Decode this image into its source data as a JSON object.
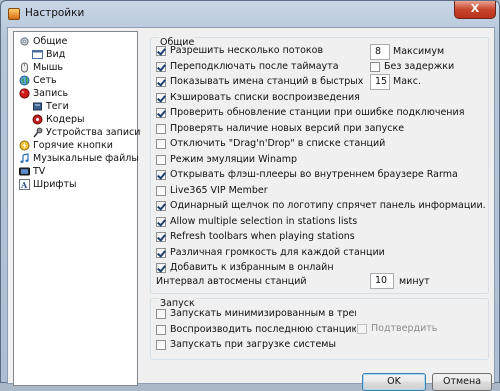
{
  "window": {
    "title": "Настройки",
    "close_label": "X"
  },
  "tree": {
    "items": [
      {
        "label": "Общие"
      },
      {
        "label": "Вид"
      },
      {
        "label": "Мышь"
      },
      {
        "label": "Сеть"
      },
      {
        "label": "Запись"
      },
      {
        "label": "Теги"
      },
      {
        "label": "Кодеры"
      },
      {
        "label": "Устройства записи"
      },
      {
        "label": "Горячие кнопки"
      },
      {
        "label": "Музыкальные файлы"
      },
      {
        "label": "TV"
      },
      {
        "label": "Шрифты"
      }
    ]
  },
  "general": {
    "title": "Общие",
    "options": [
      {
        "label": "Разрешить несколько потоков",
        "checked": true
      },
      {
        "label": "Переподключать после таймаута",
        "checked": true
      },
      {
        "label": "Показывать имена станций в быстрых предустановках",
        "checked": true
      },
      {
        "label": "Кэшировать списки воспроизведения",
        "checked": true
      },
      {
        "label": "Проверить обновление станции при ошибке подключения",
        "checked": true
      },
      {
        "label": "Проверять наличие новых версий при запуске",
        "checked": false
      },
      {
        "label": "Отключить \"Drag'n'Drop\" в списке станций",
        "checked": false
      },
      {
        "label": "Режим эмуляции Winamp",
        "checked": false
      },
      {
        "label": "Открывать флэш-плееры во внутреннем браузере Rarma",
        "checked": true
      },
      {
        "label": "Live365 VIP Member",
        "checked": false
      },
      {
        "label": "Одинарный щелчок по логотипу спрячет панель информации.",
        "checked": true
      },
      {
        "label": "Allow multiple selection in stations lists",
        "checked": true
      },
      {
        "label": "Refresh toolbars when playing stations",
        "checked": true
      },
      {
        "label": "Различная громкость для каждой станции",
        "checked": true
      },
      {
        "label": "Добавить к избранным в онлайн",
        "checked": true
      }
    ],
    "max_streams_value": "8",
    "max_streams_label": "Максимум",
    "no_delay_label": "Без задержки",
    "no_delay_checked": false,
    "max_names_value": "15",
    "max_names_label": "Макс.",
    "interval_label": "Интервал автосмены станций",
    "interval_value": "10",
    "interval_unit": "минут"
  },
  "launch": {
    "title": "Запуск",
    "options": [
      {
        "label": "Запускать минимизированным в трей",
        "checked": false
      },
      {
        "label": "Воспроизводить последнюю станцию",
        "checked": false
      },
      {
        "label": "Запускать при загрузке системы",
        "checked": false
      }
    ],
    "confirm_label": "Подтвердить"
  },
  "buttons": {
    "ok": "OK",
    "cancel": "Отмена"
  }
}
